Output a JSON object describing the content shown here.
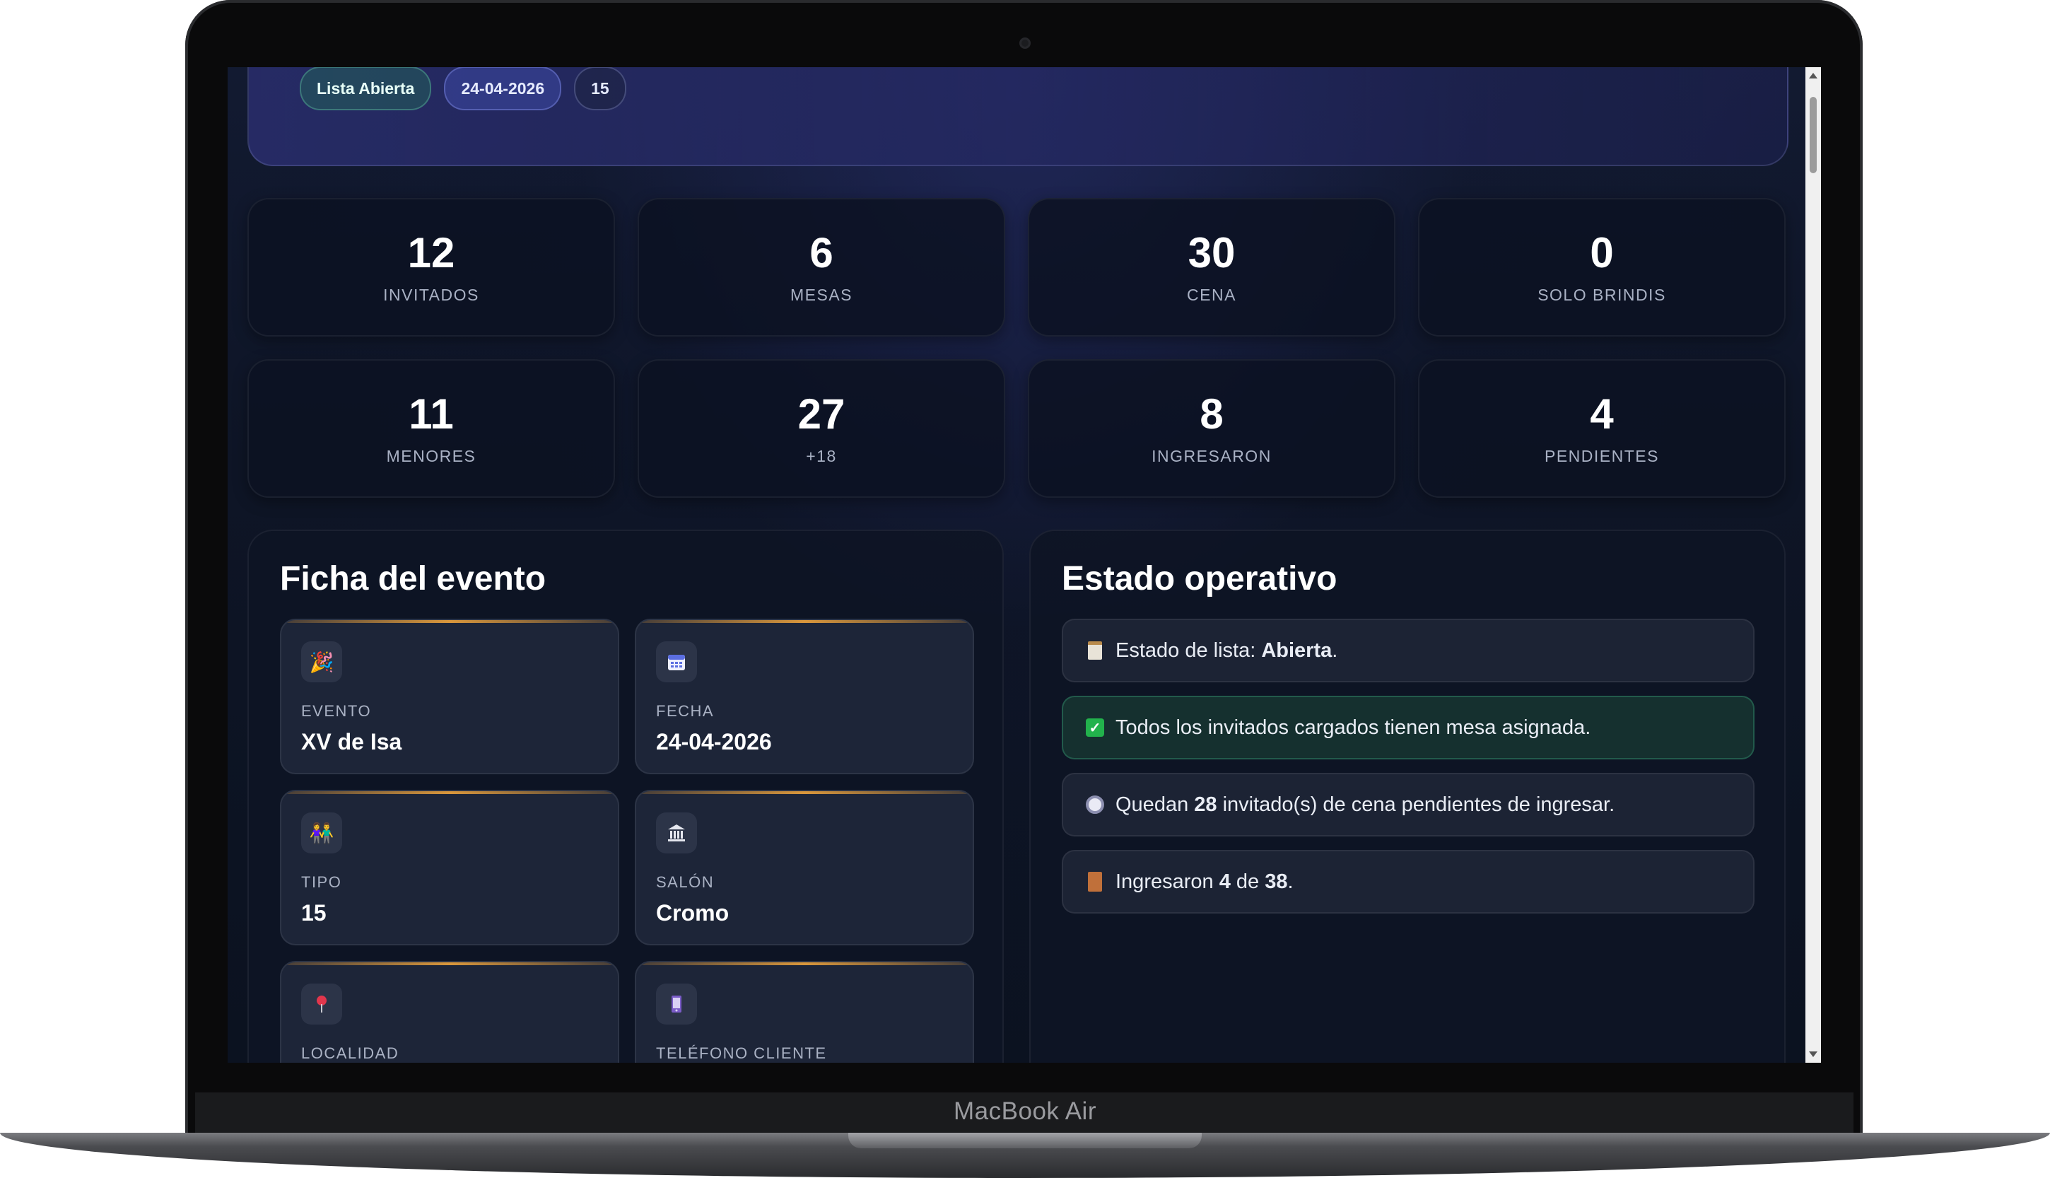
{
  "device": {
    "brand": "MacBook Air"
  },
  "header": {
    "chips": [
      {
        "label": "Lista Abierta"
      },
      {
        "label": "24-04-2026"
      },
      {
        "label": "15"
      }
    ]
  },
  "stats": [
    {
      "value": "12",
      "label": "INVITADOS"
    },
    {
      "value": "6",
      "label": "MESAS"
    },
    {
      "value": "30",
      "label": "CENA"
    },
    {
      "value": "0",
      "label": "SOLO BRINDIS"
    },
    {
      "value": "11",
      "label": "MENORES"
    },
    {
      "value": "27",
      "label": "+18"
    },
    {
      "value": "8",
      "label": "INGRESARON"
    },
    {
      "value": "4",
      "label": "PENDIENTES"
    }
  ],
  "ficha": {
    "title": "Ficha del evento",
    "cards": [
      {
        "icon": "party-popper-icon",
        "label": "EVENTO",
        "value": "XV de Isa"
      },
      {
        "icon": "calendar-icon",
        "label": "FECHA",
        "value": "24-04-2026"
      },
      {
        "icon": "couple-icon",
        "label": "TIPO",
        "value": "15"
      },
      {
        "icon": "building-icon",
        "label": "SALÓN",
        "value": "Cromo"
      },
      {
        "icon": "pin-icon",
        "label": "LOCALIDAD",
        "value": ""
      },
      {
        "icon": "phone-icon",
        "label": "TELÉFONO CLIENTE",
        "value": ""
      }
    ]
  },
  "estado": {
    "title": "Estado operativo",
    "items": [
      {
        "icon": "clipboard-icon",
        "pre": "Estado de lista: ",
        "bold": "Abierta",
        "post": "."
      },
      {
        "icon": "check-icon",
        "pre": "Todos los invitados cargados tienen mesa asignada.",
        "bold": "",
        "post": ""
      },
      {
        "icon": "plate-icon",
        "pre": "Quedan ",
        "bold": "28",
        "post": " invitado(s) de cena pendientes de ingresar."
      },
      {
        "icon": "door-icon",
        "pre": "Ingresaron ",
        "bold": "4",
        "mid": " de ",
        "bold2": "38",
        "post": "."
      }
    ]
  },
  "colors": {
    "accent_gold": "#d9973c",
    "ok_green": "#22b24c",
    "background": "#0e1526"
  }
}
